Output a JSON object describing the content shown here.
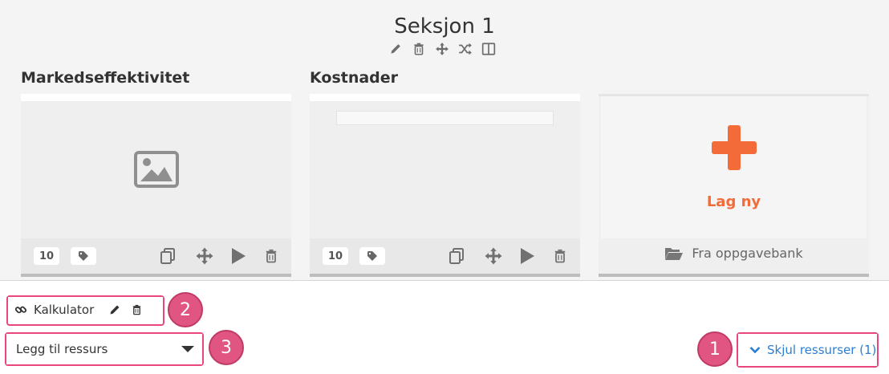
{
  "section": {
    "title": "Seksjon 1",
    "tools": [
      "pencil-icon",
      "trash-icon",
      "move-icon",
      "shuffle-icon",
      "columns-icon"
    ]
  },
  "columns": [
    {
      "title": "Markedseffektivitet",
      "badge": "10",
      "thumbnail": "image-placeholder-icon"
    },
    {
      "title": "Kostnader",
      "badge": "10",
      "thumbnail": "blank-preview"
    }
  ],
  "new_card": {
    "label": "Lag ny",
    "bank_label": "Fra oppgavebank"
  },
  "resource": {
    "label": "Kalkulator"
  },
  "add_resource": {
    "selected": "Legg til ressurs"
  },
  "toggle": {
    "label": "Skjul ressurser (1)"
  },
  "callouts": [
    "1",
    "2",
    "3"
  ],
  "colors": {
    "accent": "#f26b38",
    "highlight": "#e8467c",
    "link": "#2a7fd4"
  }
}
